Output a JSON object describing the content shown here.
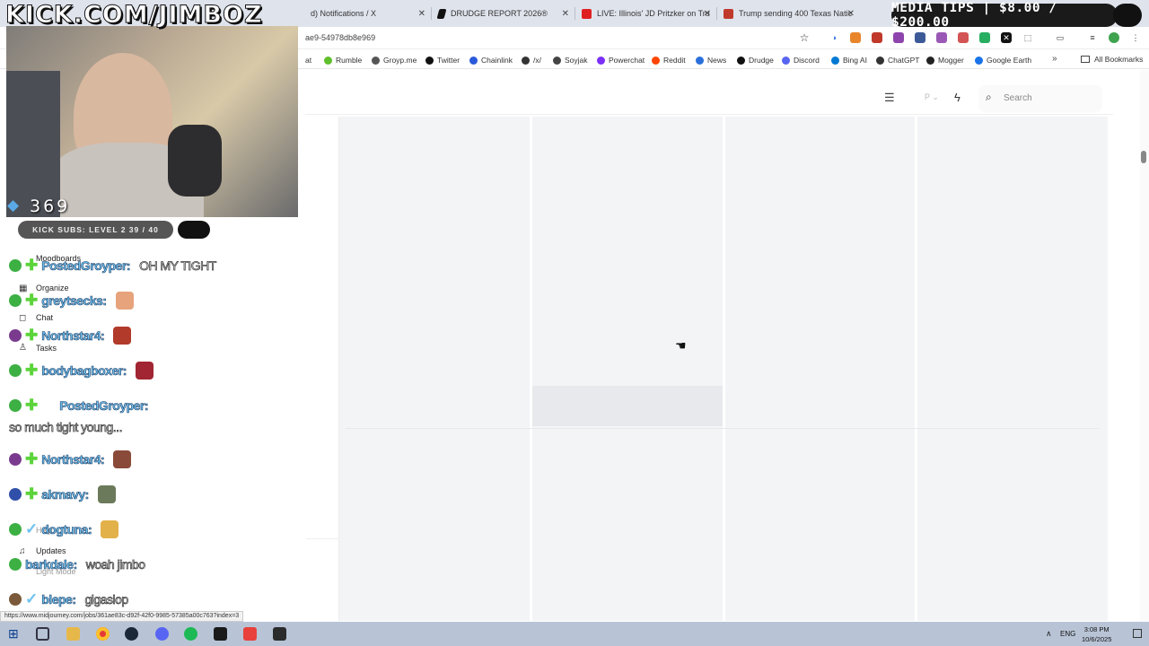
{
  "browser": {
    "tabs": [
      {
        "label": "d) Notifications / X",
        "color": "#111111"
      },
      {
        "label": "DRUDGE REPORT 2026®",
        "color": "#111111"
      },
      {
        "label": "LIVE: Illinois' JD Pritzker on Tru",
        "color": "#e02020"
      },
      {
        "label": "Trump sending 400 Texas Natic",
        "color": "#c0392b"
      }
    ],
    "url": "ae9-54978db8e969",
    "bookmarks": [
      {
        "label": "at",
        "color": "#9b59b6"
      },
      {
        "label": "Rumble",
        "color": "#5fbf2c"
      },
      {
        "label": "Groyp.me",
        "color": "#555555"
      },
      {
        "label": "Twitter",
        "color": "#111111"
      },
      {
        "label": "Chainlink",
        "color": "#2a5ada"
      },
      {
        "label": "/x/",
        "color": "#333333"
      },
      {
        "label": "Soyjak",
        "color": "#444444"
      },
      {
        "label": "Powerchat",
        "color": "#7b2ff7"
      },
      {
        "label": "Reddit",
        "color": "#ff4500"
      },
      {
        "label": "News",
        "color": "#2a6fdb"
      },
      {
        "label": "Drudge",
        "color": "#111111"
      },
      {
        "label": "Discord",
        "color": "#5865f2"
      },
      {
        "label": "Bing AI",
        "color": "#0078d4"
      },
      {
        "label": "ChatGPT",
        "color": "#333333"
      },
      {
        "label": "Mogger",
        "color": "#222222"
      },
      {
        "label": "Google Earth",
        "color": "#1a73e8"
      }
    ],
    "all_bookmarks": "All Bookmarks",
    "status_url": "https://www.midjourney.com/jobs/361ae83c-d92f-42f0-9985-57385a00c763?index=3"
  },
  "page": {
    "search_placeholder": "Search",
    "sidebar": [
      {
        "label": "Moodboards",
        "icon": "moodboard-icon"
      },
      {
        "label": "Organize",
        "icon": "grid-icon"
      },
      {
        "label": "Chat",
        "icon": "chat-icon"
      },
      {
        "label": "Tasks",
        "icon": "thumbs-up-icon"
      },
      {
        "label": "Help",
        "icon": "help-icon"
      },
      {
        "label": "Updates",
        "icon": "bell-icon"
      },
      {
        "label": "Light Mode",
        "icon": "sun-icon"
      }
    ]
  },
  "overlay": {
    "title": "KICK.COM/JIMBOZ",
    "viewers": "369",
    "kick_subs": "KICK SUBS: LEVEL 2 39 / 40",
    "media_tips": "MEDIA TIPS | $8.00 / $200.00",
    "chat": [
      {
        "user": "PostedGroyper:",
        "message": "OH MY TIGHT",
        "badge": "#3cb043"
      },
      {
        "user": "greytsecks:",
        "message": "",
        "badge": "#3cb043"
      },
      {
        "user": "Northstar4:",
        "message": "",
        "badge": "#7a3b8f"
      },
      {
        "user": "bodybagboxer:",
        "message": "",
        "badge": "#3cb043"
      },
      {
        "user": "PostedGroyper:",
        "message": "so much tight young...",
        "badge": "#3cb043"
      },
      {
        "user": "Northstar4:",
        "message": "",
        "badge": "#7a3b8f"
      },
      {
        "user": "akmavy:",
        "message": "",
        "badge": "#2f4fa8"
      },
      {
        "user": "dogtuna:",
        "message": "",
        "badge": "#3cb043"
      },
      {
        "user": "barkdale:",
        "message": "woah jimbo",
        "badge": "#3cb043"
      },
      {
        "user": "blepe:",
        "message": "gigaslop",
        "badge": "#7a5a3a"
      }
    ]
  },
  "taskbar": {
    "lang": "ENG",
    "time": "3:08 PM",
    "date": "10/6/2025"
  }
}
